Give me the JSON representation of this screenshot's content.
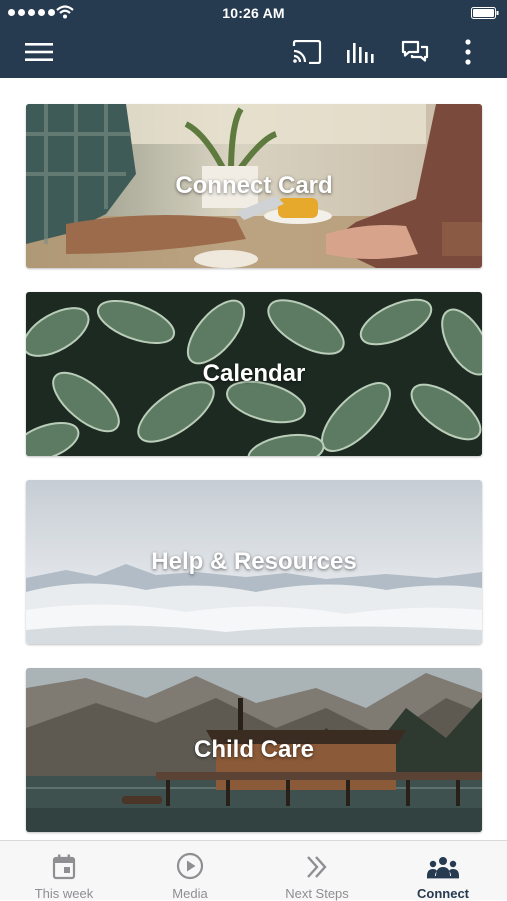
{
  "status_bar": {
    "time": "10:26 AM"
  },
  "app_bar": {
    "icons": [
      "menu-icon",
      "cast-icon",
      "audio-bars-icon",
      "chat-icon",
      "more-vert-icon"
    ],
    "background": "#263a50"
  },
  "cards": [
    {
      "label": "Connect Card"
    },
    {
      "label": "Calendar"
    },
    {
      "label": "Help & Resources"
    },
    {
      "label": "Child Care"
    }
  ],
  "tabs": [
    {
      "label": "This week",
      "icon": "calendar-icon",
      "active": false
    },
    {
      "label": "Media",
      "icon": "play-circle-icon",
      "active": false
    },
    {
      "label": "Next Steps",
      "icon": "double-chevron-icon",
      "active": false
    },
    {
      "label": "Connect",
      "icon": "people-icon",
      "active": true
    }
  ],
  "colors": {
    "accent": "#263a50",
    "inactive_tab": "#8e8e93",
    "tab_bar": "#f7f7f7"
  }
}
